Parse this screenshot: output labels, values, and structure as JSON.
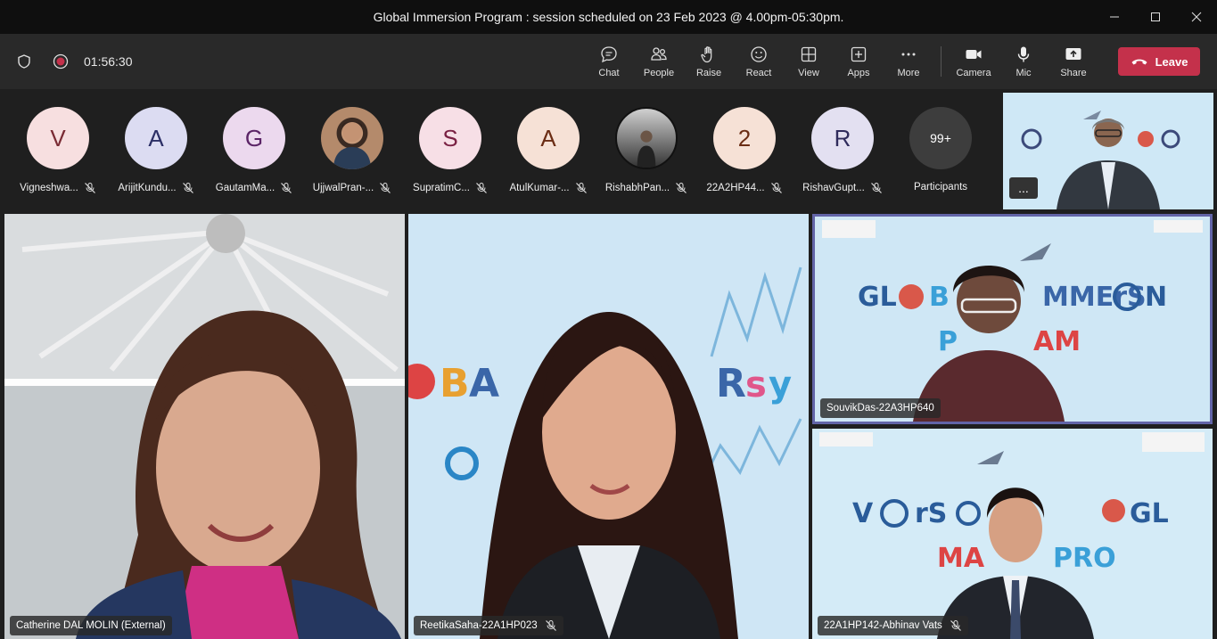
{
  "window": {
    "title": "Global Immersion Program : session scheduled on 23 Feb 2023 @ 4.00pm-05:30pm."
  },
  "meeting": {
    "timer": "01:56:30"
  },
  "toolbar": {
    "chat": "Chat",
    "people": "People",
    "raise": "Raise",
    "react": "React",
    "view": "View",
    "apps": "Apps",
    "more": "More",
    "camera": "Camera",
    "mic": "Mic",
    "share": "Share",
    "leave": "Leave"
  },
  "participants": [
    {
      "initial": "V",
      "name": "Vigneshwa...",
      "bg": "#f7dfe0",
      "fg": "#7a2b34"
    },
    {
      "initial": "A",
      "name": "ArijitKundu...",
      "bg": "#dcdcf2",
      "fg": "#2c2f66"
    },
    {
      "initial": "G",
      "name": "GautamMa...",
      "bg": "#ecd9ee",
      "fg": "#5b2466"
    },
    {
      "initial": "",
      "name": "UjjwalPran-...",
      "bg": "#b08c70",
      "fg": "#fff"
    },
    {
      "initial": "S",
      "name": "SupratimC...",
      "bg": "#f7dfe6",
      "fg": "#7a2143"
    },
    {
      "initial": "A",
      "name": "AtulKumar-...",
      "bg": "#f6e1d6",
      "fg": "#6b2c14"
    },
    {
      "initial": "",
      "name": "RishabhPan...",
      "bg": "#4a4a4a",
      "fg": "#fff"
    },
    {
      "initial": "2",
      "name": "22A2HP44...",
      "bg": "#f6e1d6",
      "fg": "#6b2c14"
    },
    {
      "initial": "R",
      "name": "RishavGupt...",
      "bg": "#e3e0f1",
      "fg": "#2f2b5c"
    }
  ],
  "participants_more": {
    "count": "99+",
    "label": "Participants"
  },
  "thumbnail": {
    "more_label": "..."
  },
  "tiles": {
    "catherine": "Catherine DAL MOLIN (External)",
    "reetika": "ReetikaSaha-22A1HP023",
    "souvik": "SouvikDas-22A3HP640",
    "abhinav": "22A1HP142-Abhinav Vats"
  },
  "colors": {
    "leave": "#c4314b",
    "active_speaker_border": "#6264a7"
  }
}
